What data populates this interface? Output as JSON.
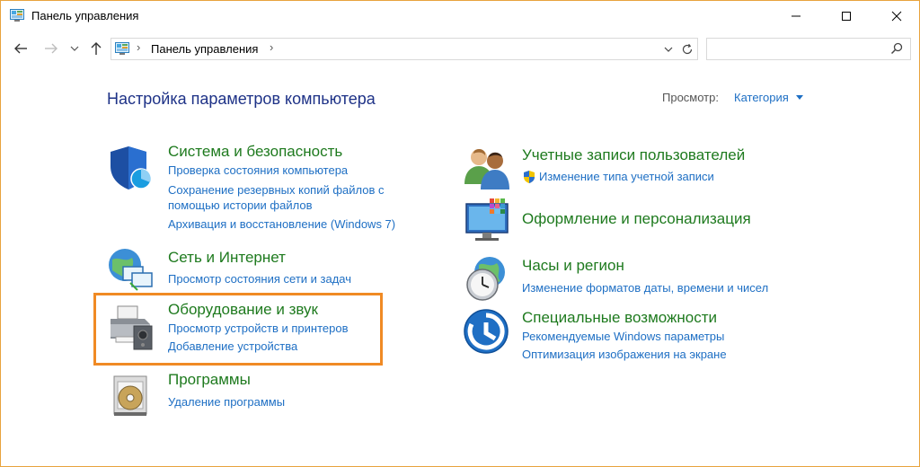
{
  "window": {
    "title": "Панель управления"
  },
  "address": {
    "crumb": "Панель управления",
    "separator": "›",
    "search_placeholder": ""
  },
  "header": {
    "title": "Настройка параметров компьютера",
    "view_label": "Просмотр:",
    "view_value": "Категория"
  },
  "categories": {
    "system": {
      "title": "Система и безопасность",
      "links": [
        "Проверка состояния компьютера",
        "Сохранение резервных копий файлов с",
        "помощью истории файлов",
        "Архивация и восстановление (Windows 7)"
      ],
      "icon": "shield-icon"
    },
    "network": {
      "title": "Сеть и Интернет",
      "links": [
        "Просмотр состояния сети и задач"
      ],
      "icon": "network-globe-icon"
    },
    "hardware": {
      "title": "Оборудование и звук",
      "links": [
        "Просмотр устройств и принтеров",
        "Добавление устройства"
      ],
      "icon": "printer-icon"
    },
    "programs": {
      "title": "Программы",
      "links": [
        "Удаление программы"
      ],
      "icon": "programs-disc-icon"
    },
    "accounts": {
      "title": "Учетные записи пользователей",
      "links": [
        "Изменение типа учетной записи"
      ],
      "icon": "users-icon"
    },
    "appearance": {
      "title": "Оформление и персонализация",
      "links": [],
      "icon": "monitor-palette-icon"
    },
    "clock": {
      "title": "Часы и регион",
      "links": [
        "Изменение форматов даты, времени и чисел"
      ],
      "icon": "clock-globe-icon"
    },
    "ease": {
      "title": "Специальные возможности",
      "links": [
        "Рекомендуемые Windows параметры",
        "Оптимизация изображения на экране"
      ],
      "icon": "ease-of-access-icon"
    }
  },
  "colors": {
    "highlight": "#f08a24",
    "title_green": "#1e7a1e",
    "link_blue": "#1e6fc4",
    "heading_blue": "#1e3287"
  }
}
